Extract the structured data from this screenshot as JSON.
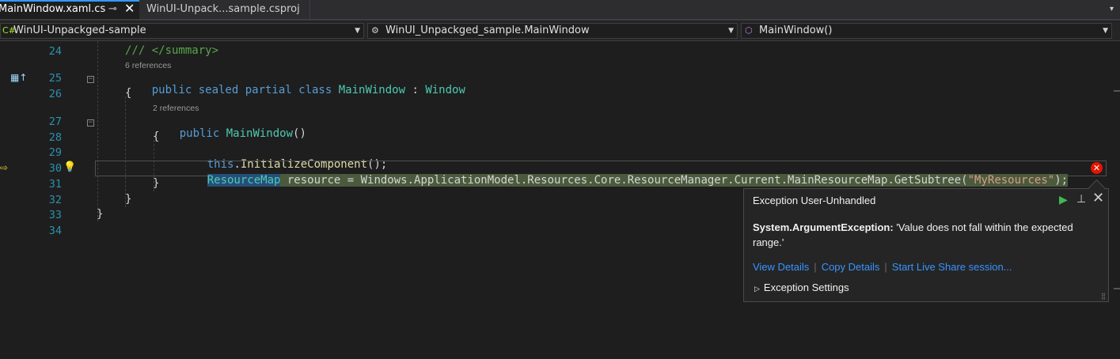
{
  "tabs": {
    "active": {
      "label": "MainWindow.xaml.cs",
      "pin": "⊸",
      "close": "✕"
    },
    "second": {
      "label": "WinUI-Unpack...sample.csproj"
    },
    "overflow": "▾"
  },
  "nav": {
    "project": "WinUI-Unpackged-sample",
    "type": "WinUI_Unpackged_sample.MainWindow",
    "member": "MainWindow()"
  },
  "editor": {
    "lines": [
      {
        "num": "24"
      },
      {
        "num": "25"
      },
      {
        "num": "26"
      },
      {
        "num": "27"
      },
      {
        "num": "28"
      },
      {
        "num": "29"
      },
      {
        "num": "30"
      },
      {
        "num": "31"
      },
      {
        "num": "32"
      },
      {
        "num": "33"
      },
      {
        "num": "34"
      }
    ],
    "codelens": {
      "class_refs": "6 references",
      "ctor_refs": "2 references"
    },
    "code": {
      "l24": "/// </summary>",
      "l25": {
        "kw": "public sealed partial class ",
        "name": "MainWindow",
        "colon": " : ",
        "base": "Window"
      },
      "l26": "{",
      "l27": {
        "kw": "public ",
        "name": "MainWindow",
        "rest": "()"
      },
      "l28": "{",
      "l29": {
        "kw": "this",
        "dot": ".",
        "meth": "InitializeComponent",
        "rest": "();"
      },
      "l30": {
        "type": "ResourceMap",
        "mid": " resource = Windows.ApplicationModel.Resources.Core.ResourceManager.Current.MainResourceMap.GetSubtree(",
        "str": "\"MyResources\"",
        "end": ");"
      },
      "l31": "}",
      "l32": "}",
      "l33": "}"
    },
    "error_marker": "✕"
  },
  "exception_popup": {
    "title": "Exception User-Unhandled",
    "exception_type": "System.ArgumentException:",
    "message": " 'Value does not fall within the expected range.'",
    "links": [
      "View Details",
      "Copy Details",
      "Start Live Share session..."
    ],
    "settings_label": "Exception Settings"
  },
  "colors": {
    "keyword": "#569cd6",
    "class": "#4ec9b0",
    "method": "#dcdcaa",
    "string": "#d69d85",
    "comment": "#57a64a",
    "line_number": "#2b91af",
    "link": "#3794ff",
    "error": "#e51400",
    "continue": "#3fb950"
  }
}
